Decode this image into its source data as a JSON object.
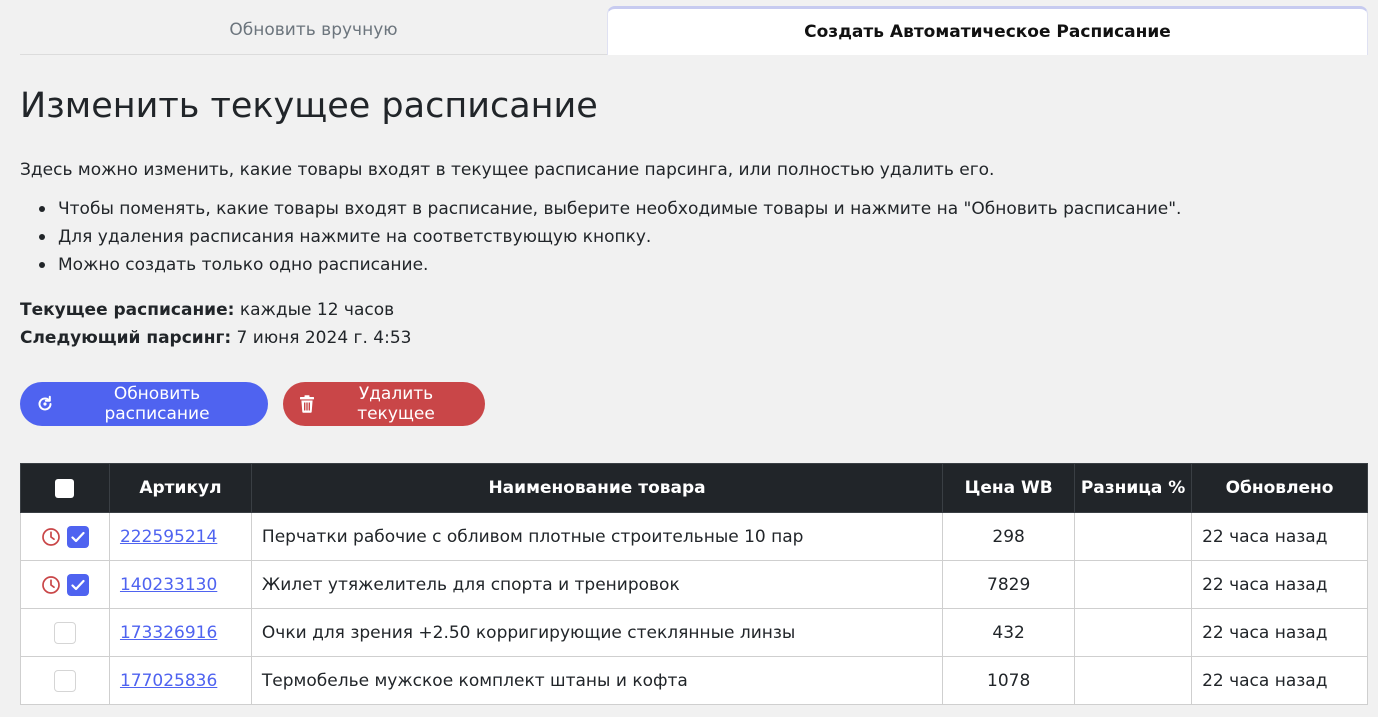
{
  "tabs": [
    {
      "label": "Обновить вручную",
      "active": false
    },
    {
      "label": "Создать Автоматическое Расписание",
      "active": true
    }
  ],
  "page": {
    "title": "Изменить текущее расписание",
    "description": "Здесь можно изменить, какие товары входят в текущее расписание парсинга, или полностью удалить его.",
    "bullets": [
      "Чтобы поменять, какие товары входят в расписание, выберите необходимые товары и нажмите на \"Обновить расписание\".",
      "Для удаления расписания нажмите на соответствующую кнопку.",
      "Можно создать только одно расписание."
    ],
    "current_schedule_label": "Текущее расписание:",
    "current_schedule_value": "каждые 12 часов",
    "next_parse_label": "Следующий парсинг:",
    "next_parse_value": "7 июня 2024 г. 4:53"
  },
  "buttons": {
    "refresh_label": "Обновить расписание",
    "delete_label": "Удалить текущее"
  },
  "colors": {
    "accent": "#4f63f0",
    "danger": "#c94648",
    "clock": "#c94648",
    "header_bg": "#212529"
  },
  "table": {
    "columns": [
      "Артикул",
      "Наименование товара",
      "Цена WB",
      "Разница %",
      "Обновлено"
    ],
    "rows": [
      {
        "scheduled": true,
        "checked": true,
        "article": "222595214",
        "name": "Перчатки рабочие с обливом плотные строительные 10 пар",
        "price": "298",
        "diff": "",
        "updated": "22 часа назад"
      },
      {
        "scheduled": true,
        "checked": true,
        "article": "140233130",
        "name": "Жилет утяжелитель для спорта и тренировок",
        "price": "7829",
        "diff": "",
        "updated": "22 часа назад"
      },
      {
        "scheduled": false,
        "checked": false,
        "article": "173326916",
        "name": "Очки для зрения +2.50 корригирующие стеклянные линзы",
        "price": "432",
        "diff": "",
        "updated": "22 часа назад"
      },
      {
        "scheduled": false,
        "checked": false,
        "article": "177025836",
        "name": "Термобелье мужское комплект штаны и кофта",
        "price": "1078",
        "diff": "",
        "updated": "22 часа назад"
      }
    ]
  }
}
